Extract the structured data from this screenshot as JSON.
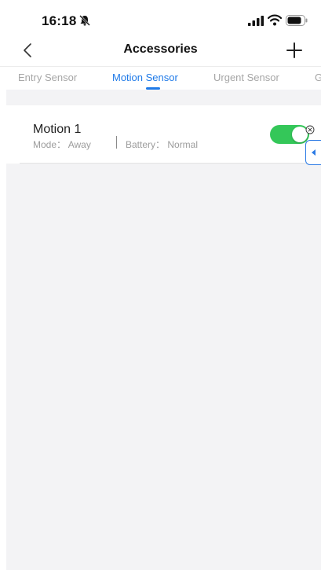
{
  "status_bar": {
    "time": "16:18",
    "icons": [
      "bell-off-icon",
      "signal-icon",
      "wifi-icon",
      "battery-icon"
    ]
  },
  "nav": {
    "title": "Accessories",
    "back_icon": "chevron-left-icon",
    "add_icon": "plus-icon"
  },
  "tabs": [
    {
      "label": "Entry Sensor",
      "active": false
    },
    {
      "label": "Motion Sensor",
      "active": true
    },
    {
      "label": "Urgent Sensor",
      "active": false
    },
    {
      "label": "G",
      "active": false
    }
  ],
  "devices": [
    {
      "name": "Motion 1",
      "mode": "Mode： Away",
      "battery": "Battery： Normal",
      "enabled": true
    }
  ],
  "colors": {
    "accent": "#1f7ae8",
    "toggle_on": "#34c759",
    "background_gray": "#f3f3f5"
  }
}
